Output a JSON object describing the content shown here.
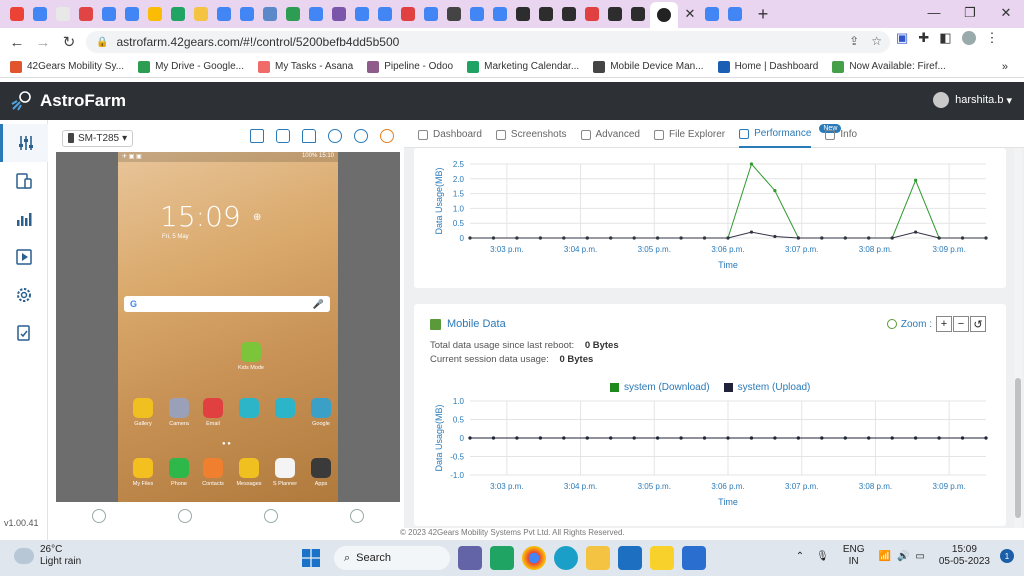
{
  "browser": {
    "url": "astrofarm.42gears.com/#!/control/5200befb4dd5b500",
    "bookmarks": [
      {
        "label": "42Gears Mobility Sy...",
        "color": "#e0552b"
      },
      {
        "label": "My Drive - Google...",
        "color": "#2d9d53"
      },
      {
        "label": "My Tasks - Asana",
        "color": "#f06a6a"
      },
      {
        "label": "Pipeline - Odoo",
        "color": "#8e5b8a"
      },
      {
        "label": "Marketing Calendar...",
        "color": "#1ea362"
      },
      {
        "label": "Mobile Device Man...",
        "color": "#444444"
      },
      {
        "label": "Home | Dashboard",
        "color": "#1a5fb4"
      },
      {
        "label": "Now Available: Firef...",
        "color": "#45a049"
      }
    ],
    "more": "»"
  },
  "app": {
    "name": "AstroFarm",
    "user": "harshita.b",
    "version": "v1.00.41",
    "footer": "© 2023 42Gears Mobility Systems Pvt Ltd. All Rights Reserved."
  },
  "device": {
    "name": "SM-T285",
    "time": "15:09",
    "date": "Fri, 5 May",
    "status_right": "100% 15:10",
    "apps": [
      {
        "label": "Kids Mode",
        "color": "#7cc43a"
      },
      {
        "label": "Gallery",
        "color": "#f0c020"
      },
      {
        "label": "Camera",
        "color": "#9aa0b8"
      },
      {
        "label": "Email",
        "color": "#e04040"
      },
      {
        "label": "",
        "color": "#2cb4c8"
      },
      {
        "label": "",
        "color": "#2cb4c8"
      },
      {
        "label": "Google",
        "color": "#3aa0c8"
      },
      {
        "label": "My Files",
        "color": "#f4c020"
      },
      {
        "label": "Phone",
        "color": "#2eb84a"
      },
      {
        "label": "Contacts",
        "color": "#f08030"
      },
      {
        "label": "Messages",
        "color": "#f0c020"
      },
      {
        "label": "S Planner",
        "color": "#f4f4f4"
      },
      {
        "label": "Apps",
        "color": "#3a3a3a"
      }
    ]
  },
  "tabs": [
    {
      "label": "Dashboard",
      "icon": "dashboard-icon"
    },
    {
      "label": "Screenshots",
      "icon": "screenshot-icon"
    },
    {
      "label": "Advanced",
      "icon": "wrench-icon"
    },
    {
      "label": "File Explorer",
      "icon": "folder-icon"
    },
    {
      "label": "Performance",
      "icon": "bar-chart-icon",
      "badge": "New"
    },
    {
      "label": "Info",
      "icon": "info-icon"
    }
  ],
  "wifi_card": {
    "ylabel": "Data Usage(MB)",
    "xlabel": "Time"
  },
  "mobile_card": {
    "title": "Mobile Data",
    "zoom_label": "Zoom :",
    "total_label": "Total data usage since last reboot:",
    "total_value": "0 Bytes",
    "session_label": "Current session data usage:",
    "session_value": "0 Bytes",
    "ylabel": "Data Usage(MB)",
    "xlabel": "Time"
  },
  "chart_data": [
    {
      "type": "line",
      "ylabel": "Data Usage(MB)",
      "xlabel": "Time",
      "ylim": [
        0,
        2.5
      ],
      "yticks": [
        "0",
        "0.5",
        "1.0",
        "1.5",
        "2.0",
        "2.5"
      ],
      "x_tick_labels": [
        "3:03 p.m.",
        "3:04 p.m.",
        "3:05 p.m.",
        "3:06 p.m.",
        "3:07 p.m.",
        "3:08 p.m.",
        "3:09 p.m."
      ],
      "series": [
        {
          "color": "#2e9a2e",
          "values": [
            0,
            0,
            0,
            0,
            0,
            0,
            0,
            0,
            0,
            0,
            0,
            0,
            2.5,
            1.6,
            0,
            0,
            0,
            0,
            0,
            1.95,
            0,
            0,
            0
          ]
        },
        {
          "color": "#333344",
          "values": [
            0,
            0,
            0,
            0,
            0,
            0,
            0,
            0,
            0,
            0,
            0,
            0,
            0.2,
            0.05,
            0,
            0,
            0,
            0,
            0,
            0.2,
            0,
            0,
            0
          ]
        }
      ]
    },
    {
      "type": "line",
      "ylabel": "Data Usage(MB)",
      "xlabel": "Time",
      "ylim": [
        -1.0,
        1.0
      ],
      "yticks": [
        "1.0",
        "0.5",
        "0",
        "-0.5",
        "-1.0"
      ],
      "x_tick_labels": [
        "3:03 p.m.",
        "3:04 p.m.",
        "3:05 p.m.",
        "3:06 p.m.",
        "3:07 p.m.",
        "3:08 p.m.",
        "3:09 p.m."
      ],
      "series": [
        {
          "name": "system (Download)",
          "color": "#1e8a1e",
          "values": [
            0,
            0,
            0,
            0,
            0,
            0,
            0,
            0,
            0,
            0,
            0,
            0,
            0,
            0,
            0,
            0,
            0,
            0,
            0,
            0,
            0,
            0,
            0
          ]
        },
        {
          "name": "system (Upload)",
          "color": "#22223a",
          "values": [
            0,
            0,
            0,
            0,
            0,
            0,
            0,
            0,
            0,
            0,
            0,
            0,
            0,
            0,
            0,
            0,
            0,
            0,
            0,
            0,
            0,
            0,
            0
          ]
        }
      ]
    }
  ],
  "taskbar": {
    "temp": "26°C",
    "weather": "Light rain",
    "search": "Search",
    "lang1": "ENG",
    "lang2": "IN",
    "time": "15:09",
    "date": "05-05-2023",
    "notif": "1"
  }
}
